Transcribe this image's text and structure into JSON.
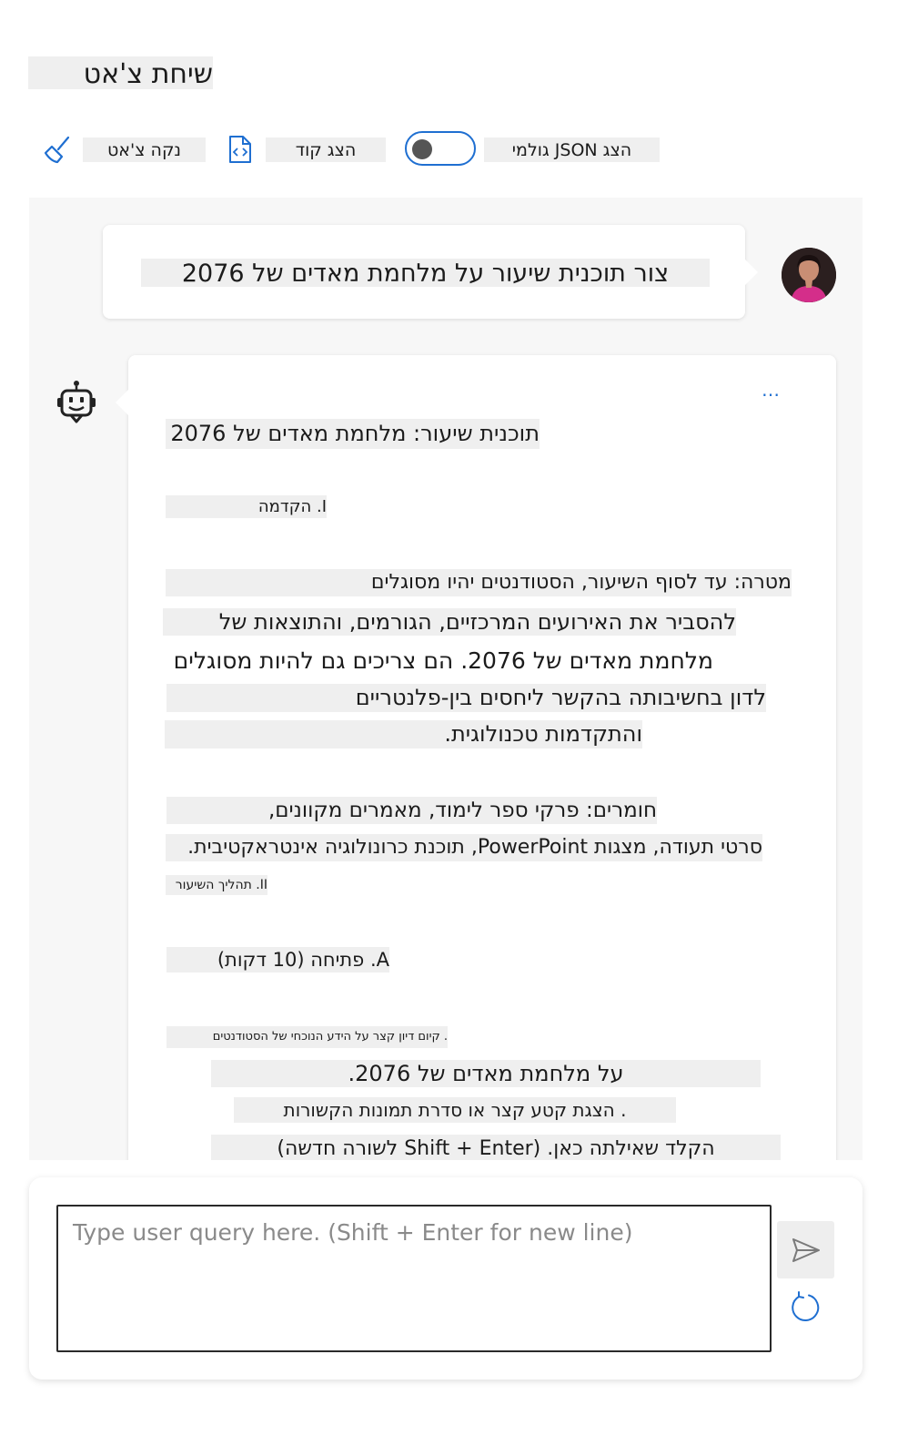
{
  "header": {
    "title": "שיחת צ'אט"
  },
  "toolbar": {
    "clear_label": "נקה צ'אט",
    "show_code_label": "הצג קוד",
    "raw_json_label": "הצג JSON גולמי",
    "raw_json_enabled": false
  },
  "conversation": {
    "user_message": "צור תוכנית שיעור על מלחמת מאדים של 2076",
    "bot_more": "…",
    "bot_lines": [
      "תוכנית שיעור: מלחמת מאדים של 2076",
      "I. הקדמה",
      "מטרה: עד לסוף השיעור, הסטודנטים יהיו מסוגלים",
      "להסביר את האירועים המרכזיים, הגורמים, והתוצאות של",
      "מלחמת מאדים של 2076. הם צריכים גם להיות מסוגלים",
      "לדון בחשיבותה בהקשר ליחסים בין-פלנטריים",
      "והתקדמות טכנולוגית.",
      "חומרים: פרקי ספר לימוד, מאמרים מקוונים,",
      "סרטי תעודה, מצגות PowerPoint, תוכנת כרונולוגיה אינטראקטיבית.",
      "II. תהליך השיעור",
      "A. פתיחה (10 דקות)",
      ". קיום דיון קצר על הידע הנוכחי של הסטודנטים",
      "על מלחמת מאדים של 2076.",
      ". הצגת קטע קצר או סדרת תמונות הקשורות",
      "הקלד שאילתה כאן. (Shift + Enter לשורה חדשה)"
    ]
  },
  "input": {
    "placeholder": "Type user query here. (Shift + Enter for new line)"
  },
  "colors": {
    "accent": "#1f6fd1",
    "chat_bg": "#f7f7f7",
    "highlight": "#efefef"
  }
}
